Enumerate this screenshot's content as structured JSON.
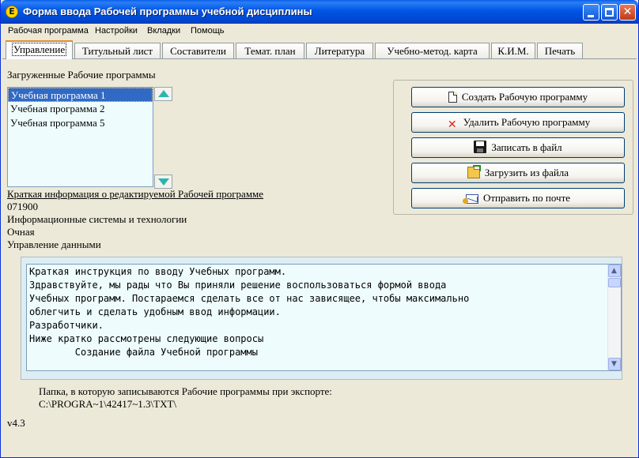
{
  "window": {
    "title": "Форма ввода Рабочей программы учебной дисциплины",
    "icon_letter": "Е",
    "accent_color": "#0055e5"
  },
  "menu": {
    "items": [
      "Рабочая программа",
      "Настройки",
      "Вкладки",
      "Помощь"
    ]
  },
  "tabs": [
    {
      "label": "Управление",
      "active": true
    },
    {
      "label": "Титульный лист",
      "active": false
    },
    {
      "label": "Составители",
      "active": false
    },
    {
      "label": "Темат. план",
      "active": false
    },
    {
      "label": "Литература",
      "active": false
    },
    {
      "label": "Учебно-метод. карта",
      "active": false
    },
    {
      "label": "К.И.М.",
      "active": false
    },
    {
      "label": "Печать",
      "active": false
    }
  ],
  "programs": {
    "heading": "Загруженные Рабочие программы",
    "items": [
      "Учебная программа 1",
      "Учебная программа 2",
      "Учебная программа 5"
    ],
    "selected_index": 0
  },
  "info": {
    "heading": "Краткая информация о редактируемой Рабочей программе",
    "code": "071900",
    "specialty": "Информационные системы и технологии",
    "form": "Очная",
    "discipline": "Управление данными"
  },
  "actions": {
    "create": "Создать Рабочую программу",
    "delete": "Удалить Рабочую программу",
    "save": "Записать в файл",
    "load": "Загрузить из файла",
    "send": "Отправить по почте"
  },
  "instructions": {
    "lines": [
      "Краткая инструкция по вводу Учебных программ.",
      "Здравствуйте, мы рады что Вы приняли решение воспользоваться формой ввода",
      "Учебных программ. Постараемся сделать все от нас зависящее, чтобы максимально",
      "облегчить и сделать удобным ввод информации.",
      "Разработчики.",
      "Ниже кратко рассмотрены следующие вопросы",
      "        Создание файла Учебной программы"
    ]
  },
  "export": {
    "label": "Папка, в которую записываются Рабочие программы при экспорте:",
    "path": "C:\\PROGRA~1\\42417~1.3\\TXT\\"
  },
  "version": "v4.3"
}
